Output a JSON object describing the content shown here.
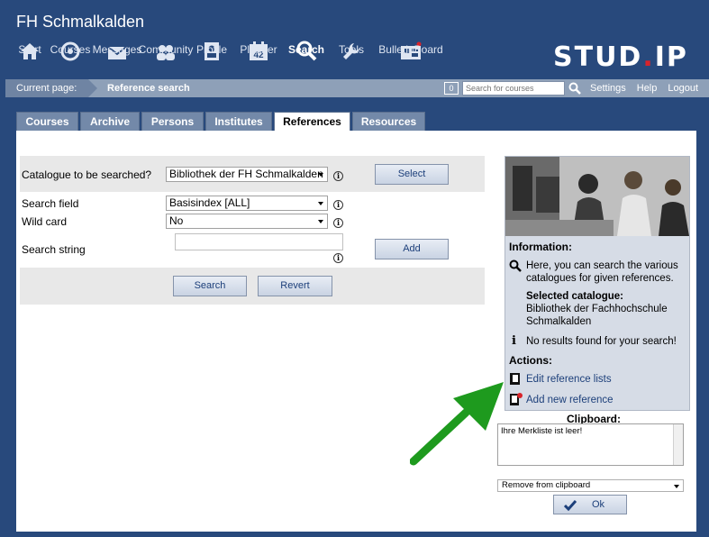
{
  "header": {
    "site_title": "FH Schmalkalden",
    "logo_text": "STUD",
    "logo_dot": ".",
    "logo_text2": "IP"
  },
  "nav": [
    {
      "label": "Start",
      "icon": "home-icon"
    },
    {
      "label": "Courses",
      "icon": "courses-icon"
    },
    {
      "label": "Messages",
      "icon": "envelope-icon"
    },
    {
      "label": "Community",
      "icon": "community-icon"
    },
    {
      "label": "Profile",
      "icon": "profile-icon"
    },
    {
      "label": "Planner",
      "icon": "calendar-icon",
      "badge": "42"
    },
    {
      "label": "Search",
      "icon": "search-icon",
      "active": true
    },
    {
      "label": "Tools",
      "icon": "wrench-icon"
    },
    {
      "label": "BulletinBoard",
      "icon": "bulletin-board-icon"
    }
  ],
  "crumb": {
    "label": "Current page:",
    "page": "Reference search",
    "badge": "0",
    "search_placeholder": "Search for courses",
    "links": [
      "Settings",
      "Help",
      "Logout"
    ]
  },
  "tabs": [
    {
      "label": "Courses"
    },
    {
      "label": "Archive"
    },
    {
      "label": "Persons"
    },
    {
      "label": "Institutes"
    },
    {
      "label": "References",
      "active": true
    },
    {
      "label": "Resources"
    }
  ],
  "form": {
    "catalogue_label": "Catalogue to be searched?",
    "catalogue_value": "Bibliothek der FH Schmalkalden",
    "select_button": "Select",
    "search_field_label": "Search field",
    "search_field_value": "Basisindex [ALL]",
    "wildcard_label": "Wild card",
    "wildcard_value": "No",
    "search_string_label": "Search string",
    "search_string_value": "",
    "add_button": "Add",
    "search_button": "Search",
    "revert_button": "Revert"
  },
  "sidebar": {
    "info_heading": "Information:",
    "info_text": "Here, you can search the various catalogues for given references.",
    "selected_heading": "Selected catalogue:",
    "selected_value": "Bibliothek der Fachhochschule Schmalkalden",
    "no_results": "No results found for your search!",
    "actions_heading": "Actions:",
    "action_edit": "Edit reference lists",
    "action_add": "Add new reference"
  },
  "clipboard": {
    "title": "Clipboard:",
    "content": "Ihre Merkliste ist leer!",
    "select_value": "Remove from clipboard",
    "ok_button": "Ok"
  },
  "colors": {
    "header_bg": "#28497c",
    "crumb_bg": "#8ea0b8",
    "arrow": "#1e9a1e",
    "logo_dot": "#d8232a"
  }
}
